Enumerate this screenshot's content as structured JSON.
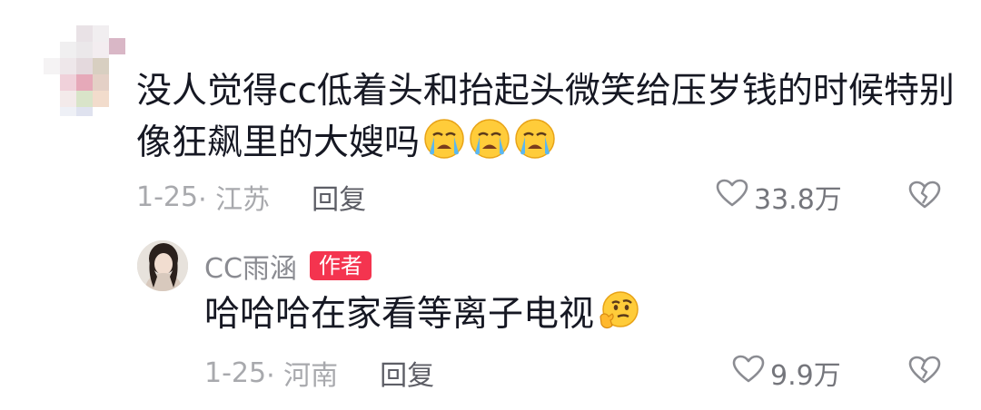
{
  "comment": {
    "text": "没人觉得cc低着头和抬起头微笑给压岁钱的时候特别像狂飙里的大嫂吗",
    "emojis": [
      "loudly-crying-face",
      "loudly-crying-face",
      "loudly-crying-face"
    ],
    "date": "1-25",
    "location": "· 江苏",
    "reply_label": "回复",
    "likes": "33.8万"
  },
  "reply": {
    "author_name": "CC雨涵",
    "author_badge": "作者",
    "text": "哈哈哈在家看等离子电视",
    "emoji": "thinking-face",
    "date": "1-25",
    "location": "· 河南",
    "reply_label": "回复",
    "likes": "9.9万"
  },
  "colors": {
    "text_primary": "#161823",
    "text_meta": "#a8a9ad",
    "reply_button": "#5d5e66",
    "badge_bg": "#f4344f",
    "badge_text": "#ffffff"
  },
  "icons": {
    "like": "heart-outline-icon",
    "dislike": "broken-heart-icon"
  }
}
